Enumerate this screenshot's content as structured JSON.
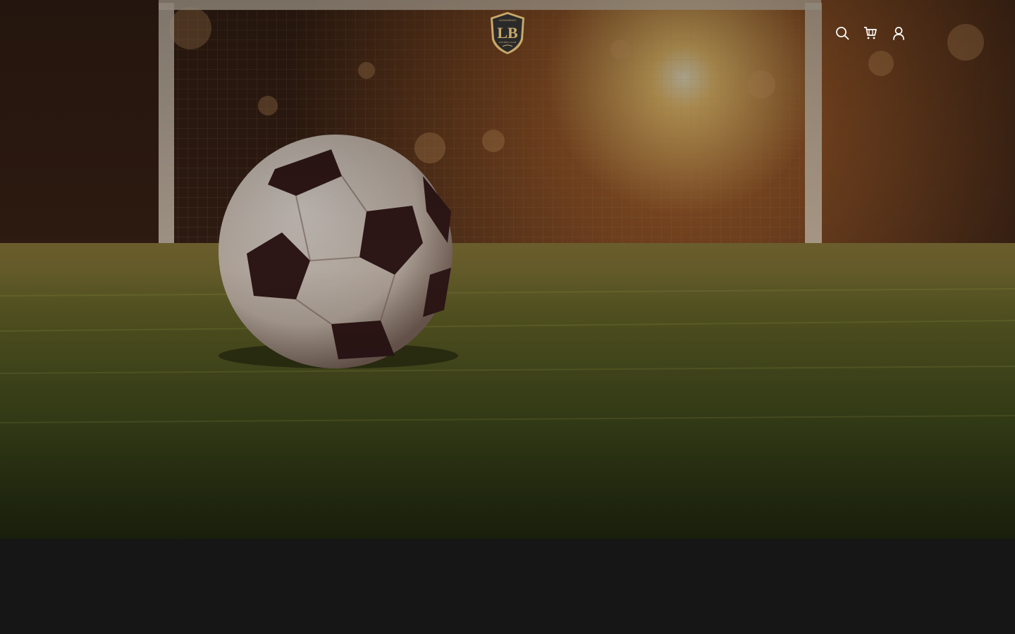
{
  "header": {
    "logo": {
      "alt": "Laguna Beach Football Club",
      "monogram": "LB",
      "top_text": "LAGUNA BEACH",
      "bottom_text": "FOOTBALL CLUB"
    },
    "icons": {
      "search": "search-icon",
      "cart": "cart-icon",
      "account": "account-icon"
    }
  },
  "hero": {
    "image_alt": "Soccer ball on grass in front of a goal at sunset"
  },
  "colors": {
    "page_background": "#161616",
    "logo_gold": "#c9a86a",
    "logo_shield": "#2a2a2a",
    "icon_white": "#ffffff"
  }
}
